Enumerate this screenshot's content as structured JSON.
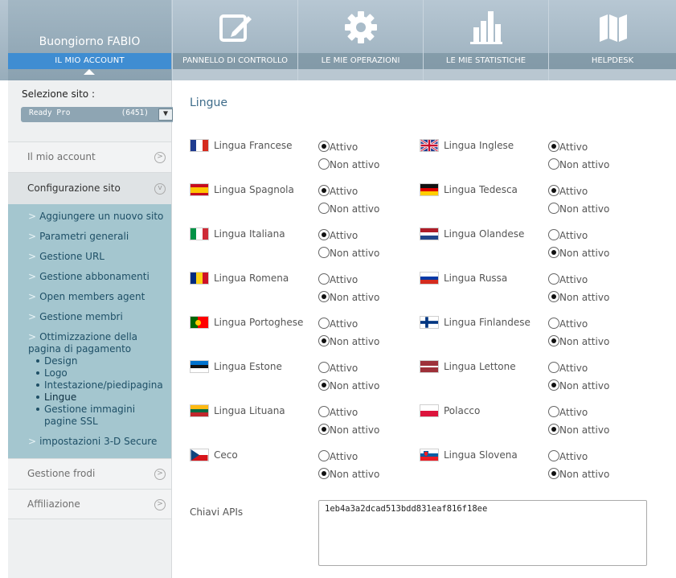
{
  "header": {
    "greeting": "Buongiorno FABIO",
    "account_tab": "IL MIO ACCOUNT",
    "tabs": [
      {
        "label": "PANNELLO DI CONTROLLO",
        "icon": "edit-icon"
      },
      {
        "label": "LE MIE OPERAZIONI",
        "icon": "gear-icon"
      },
      {
        "label": "LE MIE STATISTICHE",
        "icon": "bar-chart-icon"
      },
      {
        "label": "HELPDESK",
        "icon": "book-icon"
      }
    ]
  },
  "sidebar": {
    "site_label": "Selezione sito :",
    "site_value": "Ready Pro",
    "site_count": "(6451)",
    "items": [
      {
        "label": "Il mio account",
        "icon": ">"
      },
      {
        "label": "Configurazione sito",
        "icon": "v"
      },
      {
        "label": "Gestione frodi",
        "icon": ">"
      },
      {
        "label": "Affiliazione",
        "icon": ">"
      }
    ],
    "submenu": {
      "links": [
        "Aggiungere un nuovo sito",
        "Parametri generali",
        "Gestione URL",
        "Gestione abbonamenti",
        "Open members agent",
        "Gestione membri"
      ],
      "active_section": "Ottimizzazione della pagina di pagamento",
      "bullets": [
        "Design",
        "Logo",
        "Intestazione/piedipagina",
        "Lingue",
        "Gestione immagini pagine SSL"
      ],
      "last_link": "impostazioni 3-D Secure"
    }
  },
  "main": {
    "title": "Lingue",
    "active_label": "Attivo",
    "inactive_label": "Non attivo",
    "languages": [
      {
        "name": "Lingua Francese",
        "active": true
      },
      {
        "name": "Lingua Inglese",
        "active": true
      },
      {
        "name": "Lingua Spagnola",
        "active": true
      },
      {
        "name": "Lingua Tedesca",
        "active": true
      },
      {
        "name": "Lingua Italiana",
        "active": true
      },
      {
        "name": "Lingua Olandese",
        "active": false
      },
      {
        "name": "Lingua Romena",
        "active": false
      },
      {
        "name": "Lingua Russa",
        "active": false
      },
      {
        "name": "Lingua Portoghese",
        "active": false
      },
      {
        "name": "Lingua Finlandese",
        "active": false
      },
      {
        "name": "Lingua Estone",
        "active": false
      },
      {
        "name": "Lingua Lettone",
        "active": false
      },
      {
        "name": "Lingua Lituana",
        "active": false
      },
      {
        "name": "Polacco",
        "active": false
      },
      {
        "name": "Ceco",
        "active": false
      },
      {
        "name": "Lingua Slovena",
        "active": false
      }
    ],
    "api_label": "Chiavi APIs",
    "api_value": "1eb4a3a2dcad513bdd831eaf816f18ee"
  },
  "colors": {
    "account_tab": "#3f8dd2",
    "submenu_bg": "#a4c6cf",
    "title": "#3e6c8a"
  }
}
